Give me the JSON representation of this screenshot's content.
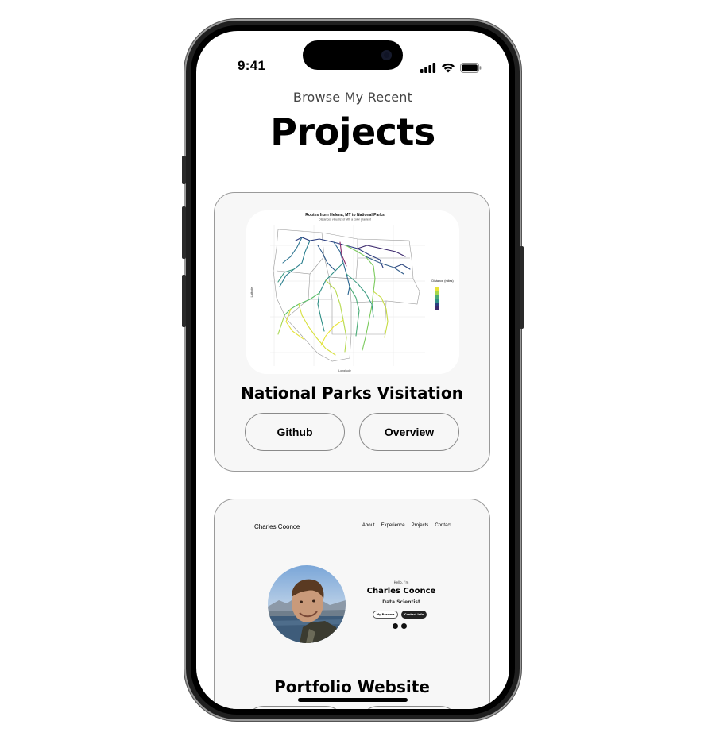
{
  "status_bar": {
    "time": "9:41"
  },
  "header": {
    "subtitle": "Browse My Recent",
    "title": "Projects"
  },
  "projects": [
    {
      "title": "National Parks Visitation",
      "thumbnail": {
        "title": "Routes from Helena, MT to National Parks",
        "subtitle": "Distances visualized with a color gradient",
        "xlabel": "Longitude",
        "ylabel": "Latitude",
        "legend_title": "Distance (miles)"
      },
      "buttons": {
        "left": "Github",
        "right": "Overview"
      }
    },
    {
      "title": "Portfolio Website",
      "thumbnail": {
        "brand": "Charles Coonce",
        "nav": [
          "About",
          "Experience",
          "Projects",
          "Contact"
        ],
        "greeting": "Hello, I'm",
        "name": "Charles Coonce",
        "role": "Data Scientist",
        "resume_button": "My Resume",
        "contact_button": "Contact Info"
      },
      "buttons": {
        "left": "",
        "right": ""
      }
    }
  ],
  "colors": {
    "card_bg": "#f7f7f7",
    "card_border": "#9a9a9a",
    "phone_frame": "#1f1f1f",
    "contact_button": "#222222"
  }
}
